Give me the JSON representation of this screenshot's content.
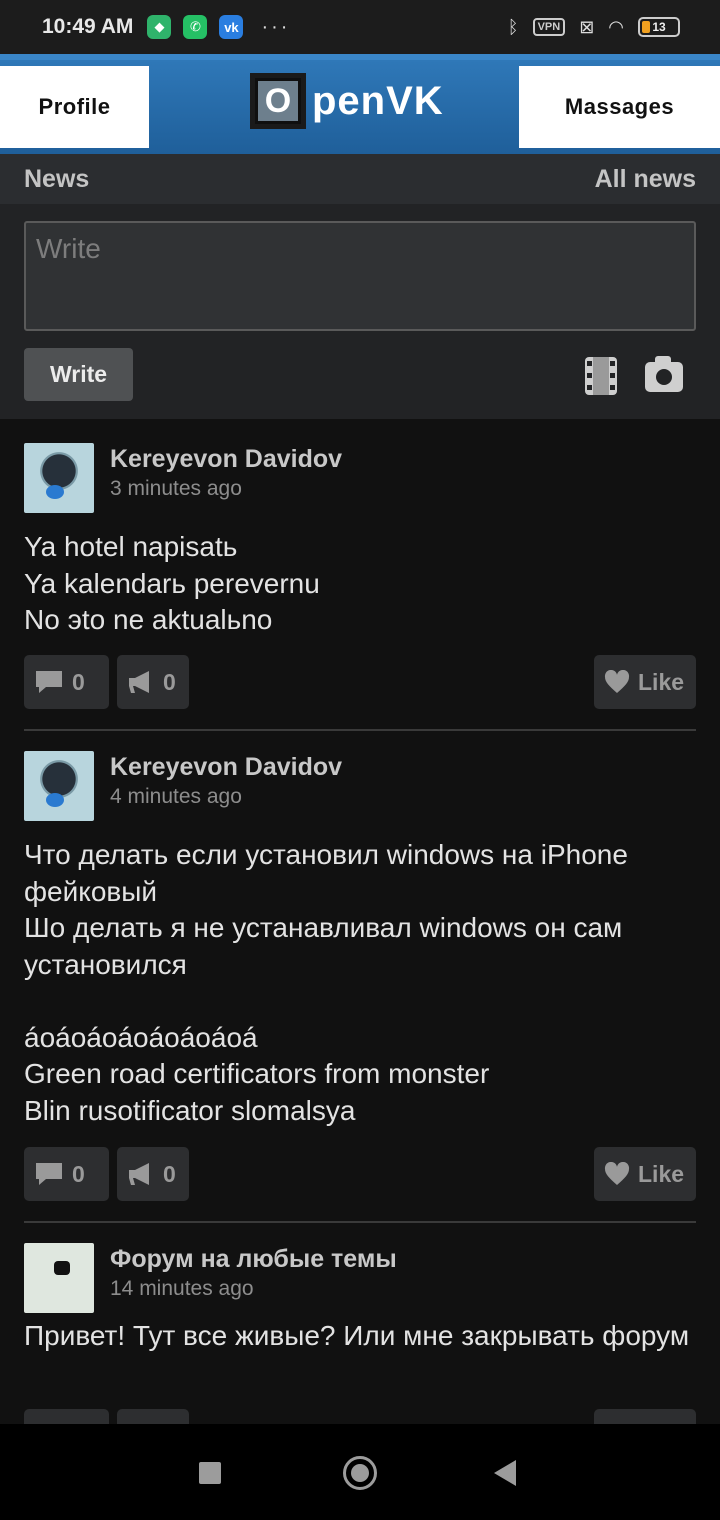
{
  "status_bar": {
    "time": "10:49 AM",
    "app_icons": [
      "shield-app-icon",
      "whatsapp-icon",
      "vk-icon"
    ],
    "more": "···",
    "vpn": "VPN",
    "battery": "13"
  },
  "header": {
    "profile_label": "Profile",
    "logo_letter": "O",
    "logo_text": "penVK",
    "messages_label": "Massages"
  },
  "news_bar": {
    "title": "News",
    "all_news": "All news"
  },
  "composer": {
    "placeholder": "Write",
    "button": "Write"
  },
  "posts": [
    {
      "author": "Kereyevon Davidov",
      "time": "3 minutes ago",
      "text": "Ya hotel napisatь\nYa kalendarь perevernu\nNo эto ne aktualьno",
      "comments": "0",
      "reposts": "0",
      "like": "Like"
    },
    {
      "author": "Kereyevon Davidov",
      "time": "4 minutes ago",
      "text": "Что делать если установил windows на iPhone фейковый\nШо делать я не устанавливал windows он сам установился\n\náoáoáoáoáoáoáoá\nGreen road certificators from monster\nBlin rusotificator slomalsya",
      "comments": "0",
      "reposts": "0",
      "like": "Like"
    },
    {
      "author": "Форум на любые темы",
      "time": "14 minutes ago",
      "text": "Привет! Тут все живые? Или мне закрывать форум"
    }
  ],
  "colors": {
    "header_blue": "#2f78b8",
    "background": "#111111",
    "panel": "#222325"
  }
}
